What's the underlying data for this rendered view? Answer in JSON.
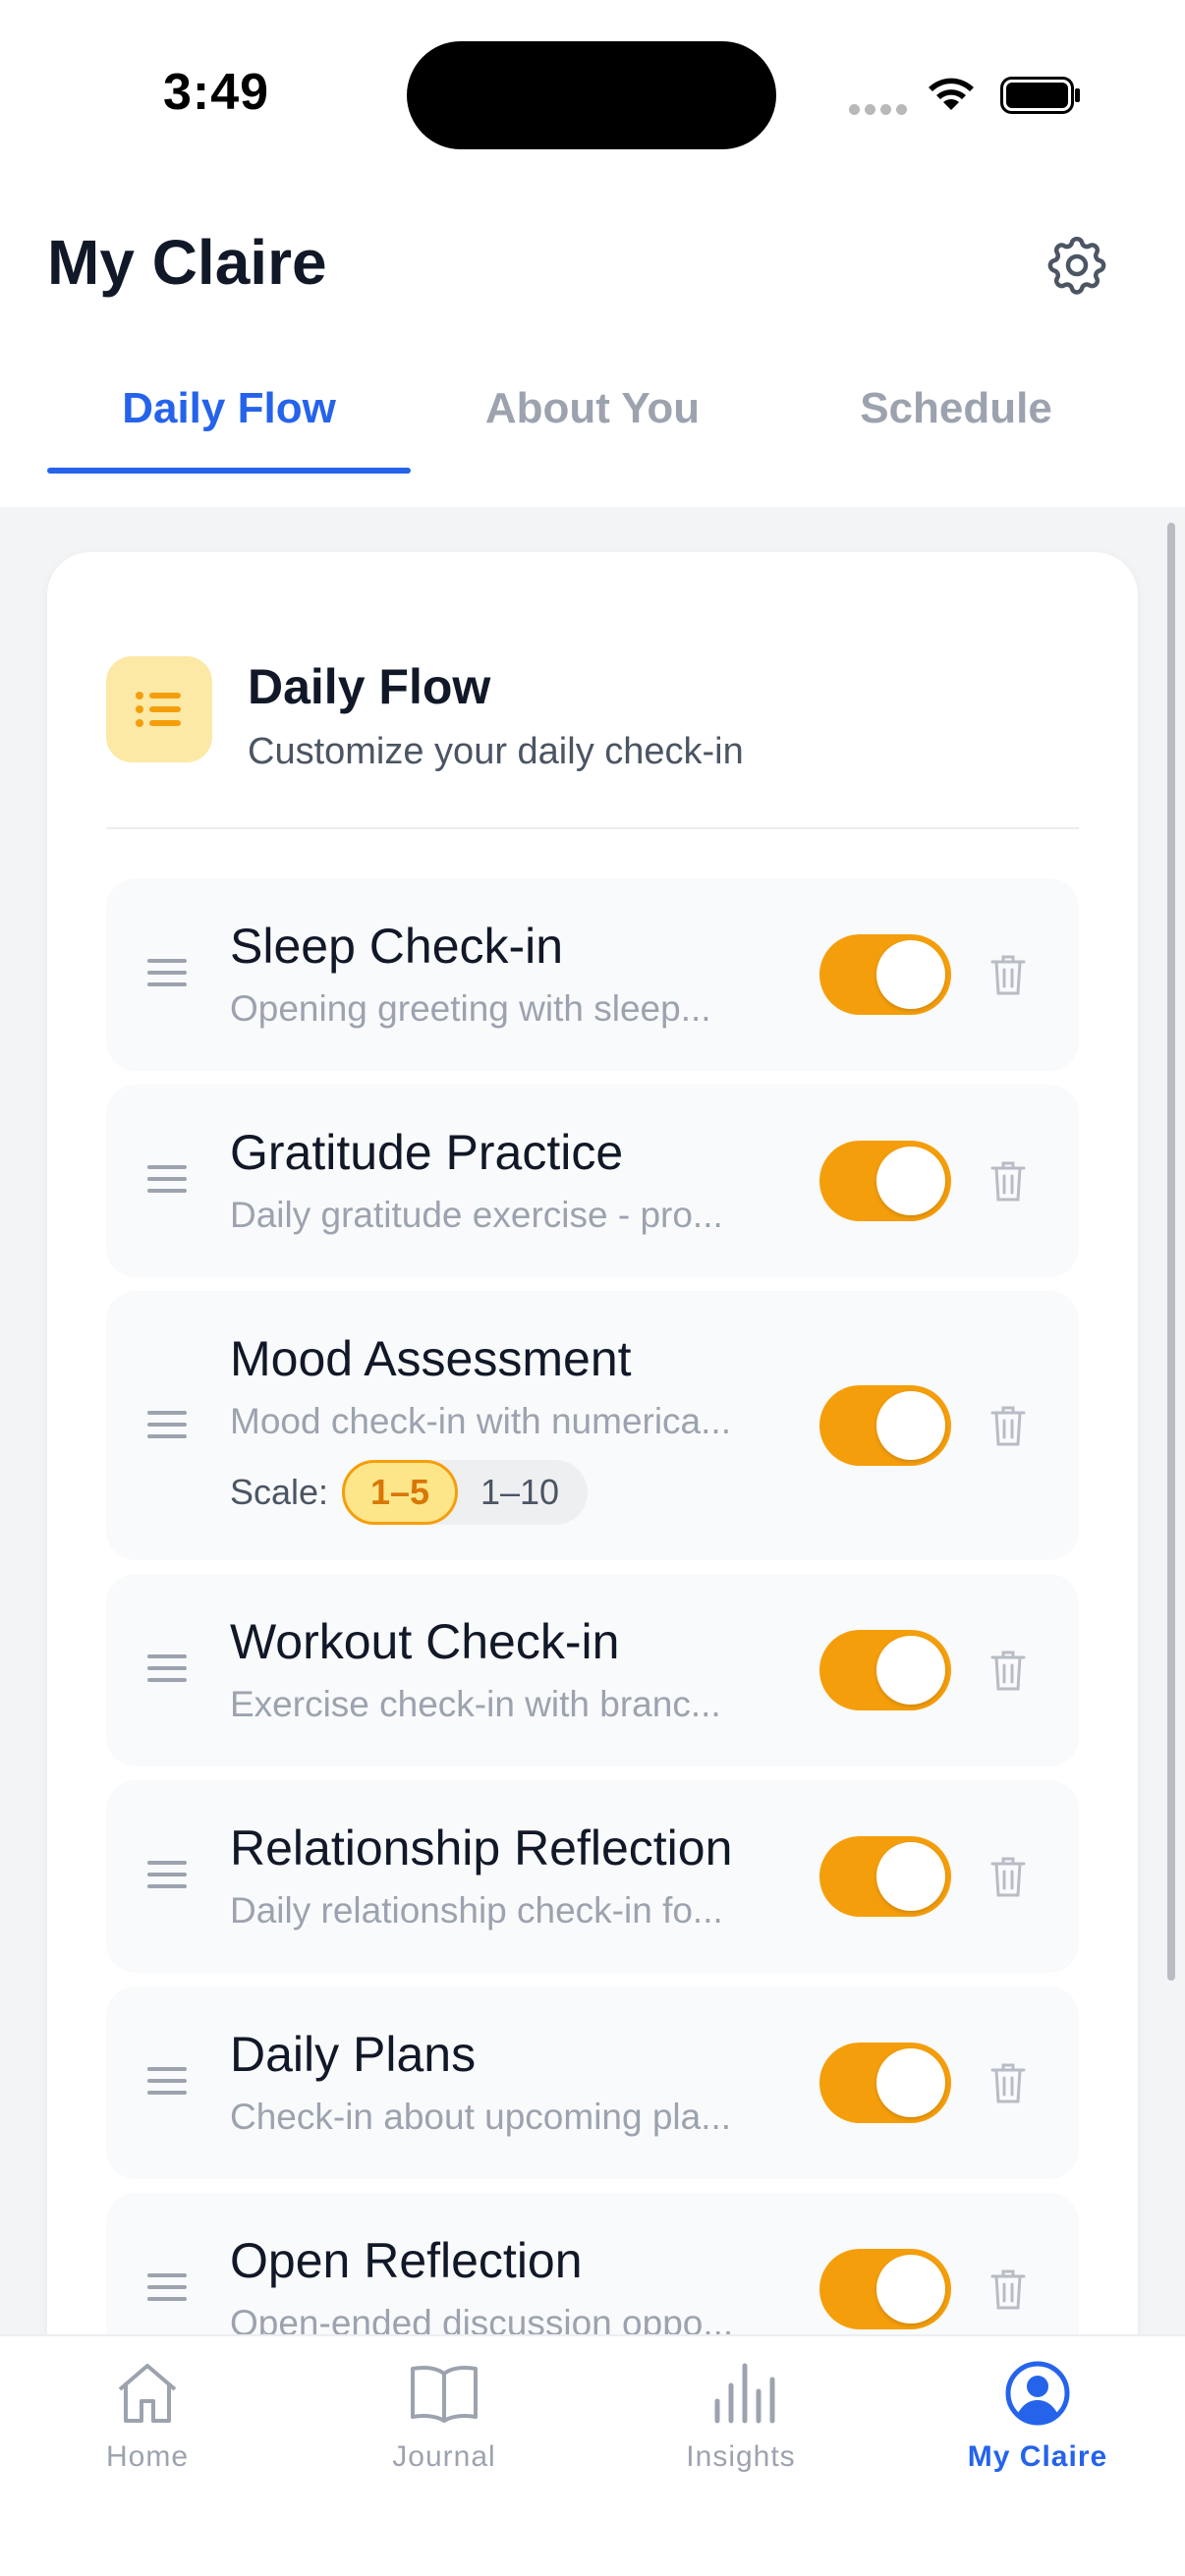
{
  "status": {
    "time": "3:49"
  },
  "header": {
    "title": "My Claire",
    "settings_icon": "gear-icon"
  },
  "tabs": [
    {
      "label": "Daily Flow",
      "active": true
    },
    {
      "label": "About You",
      "active": false
    },
    {
      "label": "Schedule",
      "active": false
    }
  ],
  "card": {
    "icon": "list-icon",
    "title": "Daily Flow",
    "subtitle": "Customize your daily check-in"
  },
  "items": [
    {
      "title": "Sleep Check-in",
      "description": "Opening greeting with sleep...",
      "enabled": true
    },
    {
      "title": "Gratitude Practice",
      "description": "Daily gratitude exercise - pro...",
      "enabled": true
    },
    {
      "title": "Mood Assessment",
      "description": "Mood check-in with numerica...",
      "enabled": true,
      "scale": {
        "label": "Scale:",
        "options": [
          "1–5",
          "1–10"
        ],
        "selected": "1–5"
      }
    },
    {
      "title": "Workout Check-in",
      "description": "Exercise check-in with branc...",
      "enabled": true
    },
    {
      "title": "Relationship Reflection",
      "description": "Daily relationship check-in fo...",
      "enabled": true
    },
    {
      "title": "Daily Plans",
      "description": "Check-in about upcoming pla...",
      "enabled": true
    },
    {
      "title": "Open Reflection",
      "description": "Open-ended discussion oppo...",
      "enabled": true
    }
  ],
  "nav": [
    {
      "label": "Home",
      "icon": "home-icon",
      "active": false
    },
    {
      "label": "Journal",
      "icon": "book-icon",
      "active": false
    },
    {
      "label": "Insights",
      "icon": "bar-chart-icon",
      "active": false
    },
    {
      "label": "My Claire",
      "icon": "profile-icon",
      "active": true
    }
  ],
  "colors": {
    "accent": "#2563eb",
    "toggle_on": "#f59e0b",
    "scale_selected_bg": "#fde68a"
  }
}
